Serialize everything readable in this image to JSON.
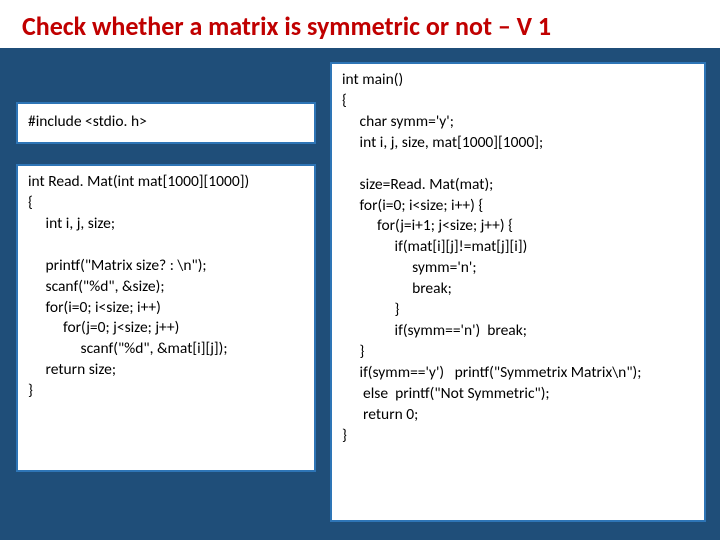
{
  "title": "Check whether a matrix is symmetric or not – V 1",
  "code": {
    "include": "#include <stdio. h>",
    "readmat": "int Read. Mat(int mat[1000][1000])\n{\n     int i, j, size;\n\n     printf(\"Matrix size? : \\n\");\n     scanf(\"%d\", &size);\n     for(i=0; i<size; i++)\n          for(j=0; j<size; j++)\n               scanf(\"%d\", &mat[i][j]);\n     return size;\n}",
    "main": "int main()\n{\n     char symm='y';\n     int i, j, size, mat[1000][1000];\n\n     size=Read. Mat(mat);\n     for(i=0; i<size; i++) {\n          for(j=i+1; j<size; j++) {\n               if(mat[i][j]!=mat[j][i])\n                    symm='n';\n                    break;\n               }\n               if(symm=='n')  break;\n     }\n     if(symm=='y')   printf(\"Symmetrix Matrix\\n\");\n      else  printf(\"Not Symmetric\");\n      return 0;\n}"
  }
}
